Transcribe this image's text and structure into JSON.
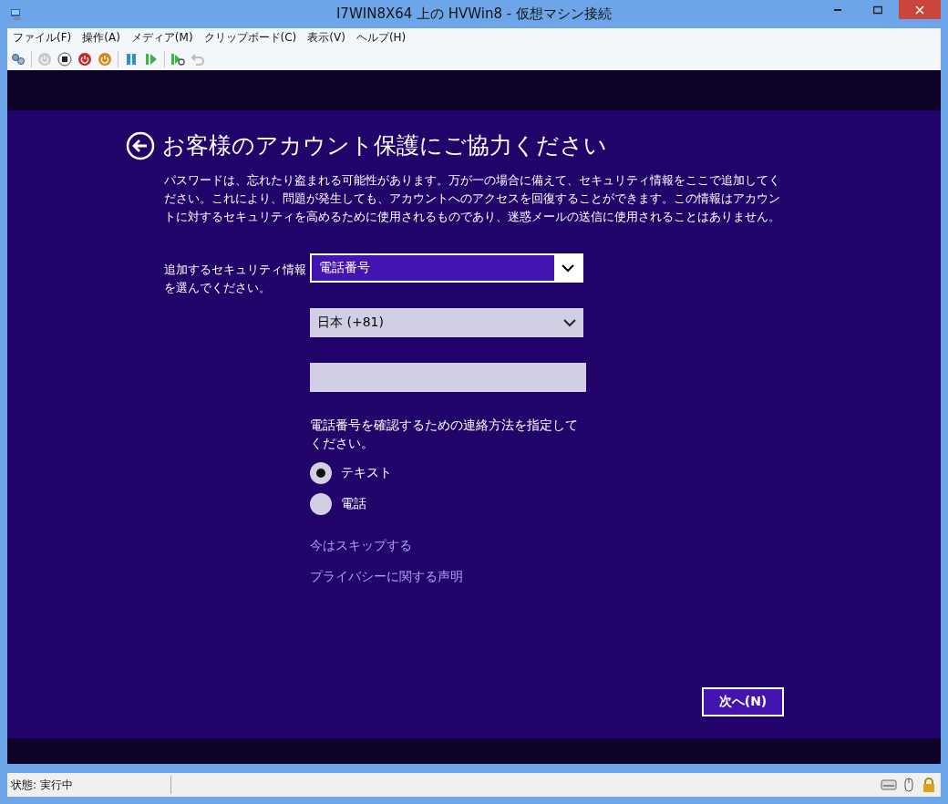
{
  "window": {
    "title": "I7WIN8X64 上の HVWin8  - 仮想マシン接続"
  },
  "menu": [
    "ファイル(F)",
    "操作(A)",
    "メディア(M)",
    "クリップボード(C)",
    "表示(V)",
    "ヘルプ(H)"
  ],
  "page": {
    "heading": "お客様のアカウント保護にご協力ください",
    "description": "パスワードは、忘れたり盗まれる可能性があります。万が一の場合に備えて、セキュリティ情報をここで追加してください。これにより、問題が発生しても、アカウントへのアクセスを回復することができます。この情報はアカウントに対するセキュリティを高めるために使用されるものであり、迷惑メールの送信に使用されることはありません。",
    "security_label": "追加するセキュリティ情報を選んでください。",
    "security_select": {
      "value": "電話番号",
      "focused": true
    },
    "country_select": {
      "value": "日本 (+81)",
      "focused": false
    },
    "contact_prompt": "電話番号を確認するための連絡方法を指定してください。",
    "contact_options": [
      {
        "label": "テキスト",
        "selected": true
      },
      {
        "label": "電話",
        "selected": false
      }
    ],
    "links": [
      "今はスキップする",
      "プライバシーに関する声明"
    ],
    "next_button": "次へ(N)"
  },
  "status_bar": {
    "status": "状態: 実行中"
  }
}
